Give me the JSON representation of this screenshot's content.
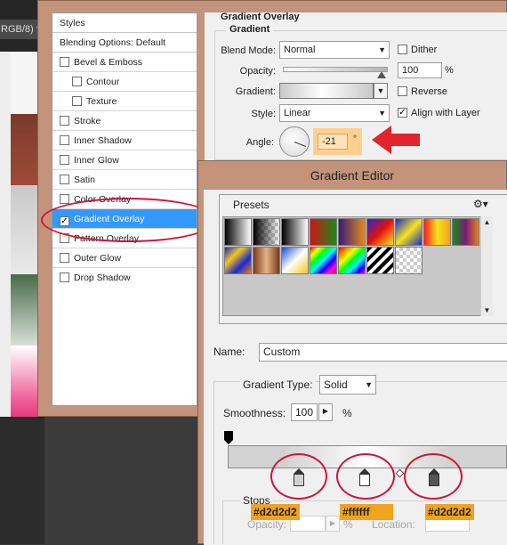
{
  "document_tab": {
    "label": "RGB/8) *"
  },
  "layer_style": {
    "styles": [
      {
        "label": "Styles",
        "type": "header"
      },
      {
        "label": "Blending Options: Default",
        "type": "header"
      },
      {
        "label": "Bevel & Emboss",
        "checked": false
      },
      {
        "label": "Contour",
        "checked": false,
        "sub": true
      },
      {
        "label": "Texture",
        "checked": false,
        "sub": true
      },
      {
        "label": "Stroke",
        "checked": false
      },
      {
        "label": "Inner Shadow",
        "checked": false
      },
      {
        "label": "Inner Glow",
        "checked": false
      },
      {
        "label": "Satin",
        "checked": false
      },
      {
        "label": "Color Overlay",
        "checked": false
      },
      {
        "label": "Gradient Overlay",
        "checked": true,
        "selected": true
      },
      {
        "label": "Pattern Overlay",
        "checked": false
      },
      {
        "label": "Outer Glow",
        "checked": false
      },
      {
        "label": "Drop Shadow",
        "checked": false
      }
    ],
    "gradient_overlay": {
      "section_title": "Gradient Overlay",
      "group_title": "Gradient",
      "blend_mode_label": "Blend Mode:",
      "blend_mode_value": "Normal",
      "dither_label": "Dither",
      "dither_checked": false,
      "opacity_label": "Opacity:",
      "opacity_value": "100",
      "opacity_unit": "%",
      "gradient_label": "Gradient:",
      "reverse_label": "Reverse",
      "reverse_checked": false,
      "style_label": "Style:",
      "style_value": "Linear",
      "align_label": "Align with Layer",
      "align_checked": true,
      "angle_label": "Angle:",
      "angle_value": "-21",
      "angle_unit": "°"
    }
  },
  "gradient_editor": {
    "title": "Gradient Editor",
    "presets_label": "Presets",
    "name_label": "Name:",
    "name_value": "Custom",
    "gradient_type_label": "Gradient Type:",
    "gradient_type_value": "Solid",
    "smoothness_label": "Smoothness:",
    "smoothness_value": "100",
    "smoothness_unit": "%",
    "stops_label": "Stops",
    "opacity_label": "Opacity:",
    "opacity_unit": "%",
    "location_label": "Location:",
    "color_stops": [
      {
        "hex_label": "#d2d2d2",
        "color": "#d2d2d2"
      },
      {
        "hex_label": "#ffffff",
        "color": "#ffffff"
      },
      {
        "hex_label": "#d2d2d2",
        "color": "#d2d2d2"
      }
    ]
  },
  "colors": {
    "dialog_frame": "#c3947b",
    "selection": "#3399ff",
    "annotation_red": "#d0143a",
    "annotation_orange": "#f0a31f"
  }
}
